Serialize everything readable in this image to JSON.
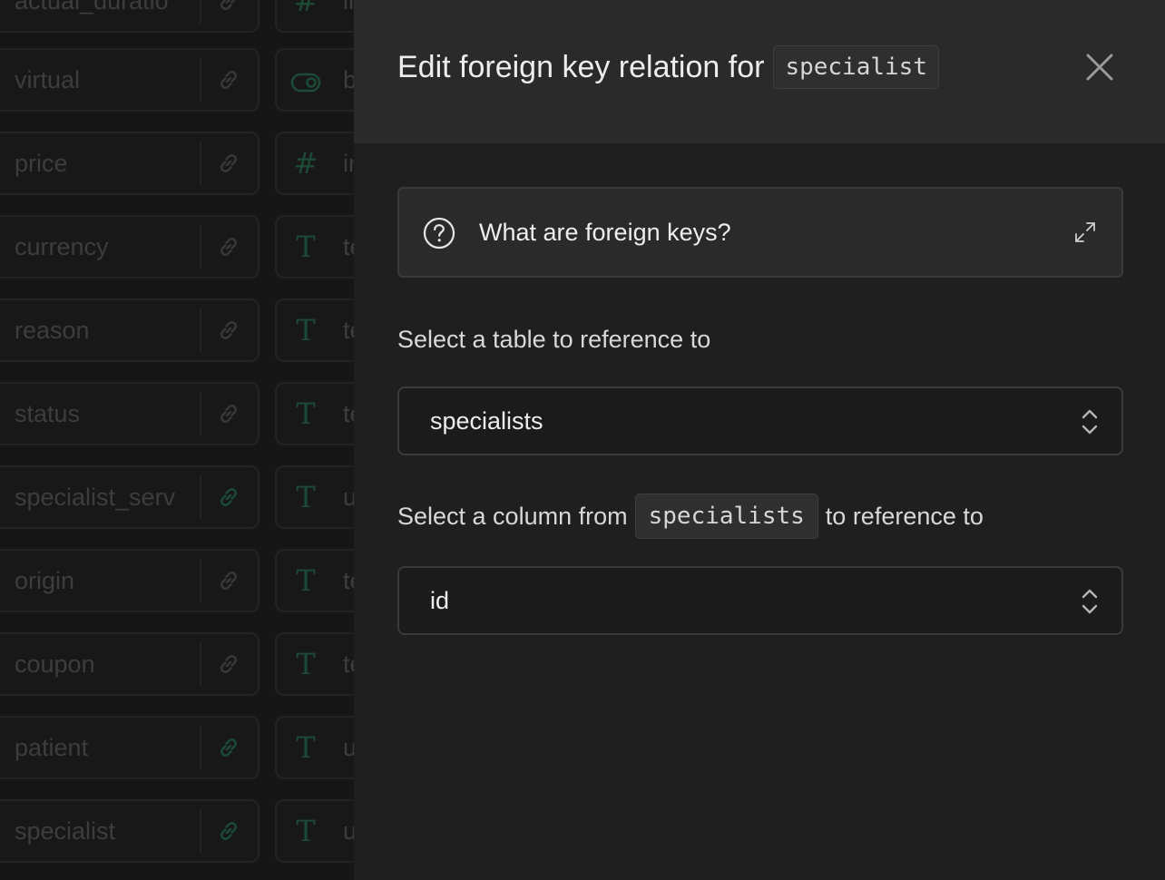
{
  "background_columns": [
    {
      "name": "actual_duratio",
      "type_icon": "#",
      "type_text": "in",
      "link_active": false
    },
    {
      "name": "virtual",
      "type_icon": "toggle",
      "type_text": "b",
      "link_active": false
    },
    {
      "name": "price",
      "type_icon": "#",
      "type_text": "in",
      "link_active": false
    },
    {
      "name": "currency",
      "type_icon": "T",
      "type_text": "te",
      "link_active": false
    },
    {
      "name": "reason",
      "type_icon": "T",
      "type_text": "te",
      "link_active": false
    },
    {
      "name": "status",
      "type_icon": "T",
      "type_text": "te",
      "link_active": false
    },
    {
      "name": "specialist_serv",
      "type_icon": "T",
      "type_text": "u",
      "link_active": true
    },
    {
      "name": "origin",
      "type_icon": "T",
      "type_text": "te",
      "link_active": false
    },
    {
      "name": "coupon",
      "type_icon": "T",
      "type_text": "te",
      "link_active": false
    },
    {
      "name": "patient",
      "type_icon": "T",
      "type_text": "u",
      "link_active": true
    },
    {
      "name": "specialist",
      "type_icon": "T",
      "type_text": "u",
      "link_active": true
    }
  ],
  "panel": {
    "title": "Edit foreign key relation for",
    "title_code": "specialist",
    "help_text": "What are foreign keys?",
    "table_label": "Select a table to reference to",
    "table_value": "specialists",
    "column_label_pre": "Select a column from",
    "column_label_code": "specialists",
    "column_label_post": "to reference to",
    "column_value": "id"
  },
  "colors": {
    "panel_bg": "#1f1f1f",
    "header_bg": "#2a2a2a",
    "accent_green": "#1c4a37",
    "text_primary": "#ededed"
  }
}
